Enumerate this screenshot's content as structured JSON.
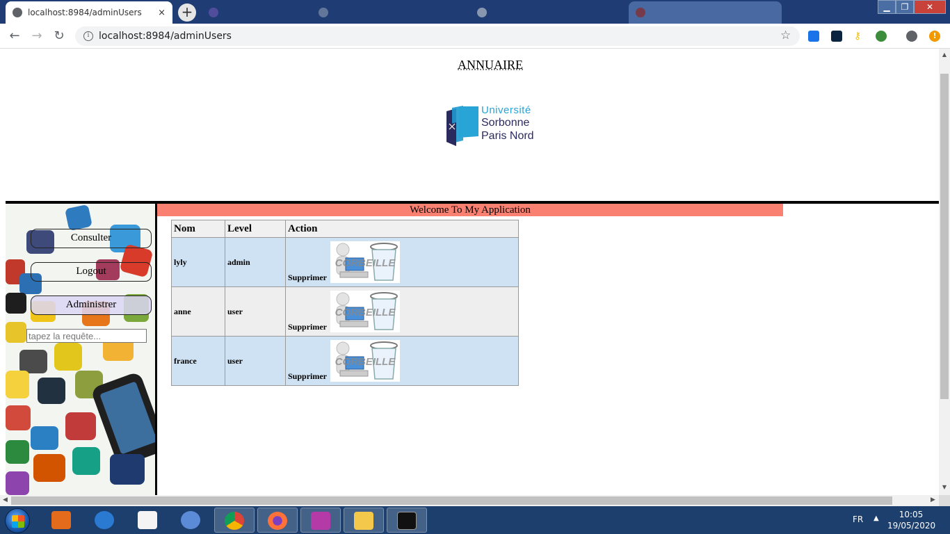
{
  "browser": {
    "tabs": [
      {
        "title": "localhost:8984/adminUsers",
        "active": true
      },
      {
        "title": "",
        "active": false
      },
      {
        "title": "",
        "active": false
      },
      {
        "title": "",
        "active": false
      },
      {
        "title": "",
        "active": false
      }
    ],
    "tab_close_glyph": "×",
    "new_tab_glyph": "+",
    "url": "localhost:8984/adminUsers"
  },
  "page": {
    "title": "ANNUAIRE",
    "logo": {
      "line1": "Université",
      "line2": "Sorbonne",
      "line3": "Paris Nord"
    },
    "welcome": "Welcome To My Application",
    "sidebar": {
      "buttons": [
        "Consulter",
        "Logout",
        "Administrer"
      ],
      "search_placeholder": "tapez la requête..."
    },
    "table": {
      "headers": [
        "Nom",
        "Level",
        "Action"
      ],
      "rows": [
        {
          "nom": "lyly",
          "level": "admin",
          "action": "Supprimer"
        },
        {
          "nom": "anne",
          "level": "user",
          "action": "Supprimer"
        },
        {
          "nom": "france",
          "level": "user",
          "action": "Supprimer"
        }
      ],
      "trash_label": "CORBEILLE"
    }
  },
  "taskbar": {
    "language": "FR",
    "time": "10:05",
    "date": "19/05/2020"
  },
  "colors": {
    "welcome_bg": "#fa8072",
    "row_odd": "#cfe2f3",
    "row_even": "#eeeeee",
    "tabstrip": "#1f3c74",
    "taskbar": "#1c3f6e"
  }
}
